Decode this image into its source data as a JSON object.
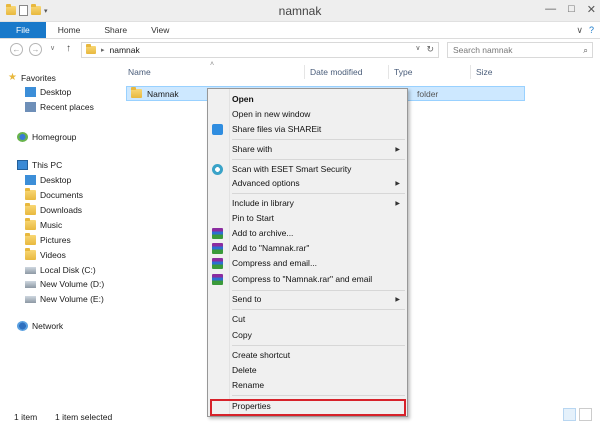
{
  "window": {
    "title": "namnak",
    "controls": [
      "—",
      "□",
      "✕"
    ]
  },
  "ribbon": {
    "tabs": [
      "File",
      "Home",
      "Share",
      "View"
    ],
    "chevron": "∨",
    "help": "?"
  },
  "navigation": {
    "back": "←",
    "forward": "→",
    "recent": "∨",
    "up": "↑",
    "path": [
      "namnak"
    ],
    "path_sep": "▸",
    "address_dropdown": "∨",
    "refresh": "↻",
    "search_placeholder": "Search namnak",
    "search_glyph": "⌕"
  },
  "sidebar": {
    "favorites": "Favorites",
    "favorites_items": [
      "Desktop",
      "Recent places"
    ],
    "homegroup": "Homegroup",
    "thispc": "This PC",
    "thispc_items": [
      "Desktop",
      "Documents",
      "Downloads",
      "Music",
      "Pictures",
      "Videos",
      "Local Disk (C:)",
      "New Volume (D:)",
      "New Volume (E:)"
    ],
    "network": "Network"
  },
  "columns": {
    "sort_indicator": "˄",
    "name": "Name",
    "date": "Date modified",
    "type": "Type",
    "size": "Size"
  },
  "files": [
    {
      "name": "Namnak",
      "type": "folder"
    }
  ],
  "context_menu": {
    "items": [
      {
        "label": "Open",
        "bold": true
      },
      {
        "label": "Open in new window"
      },
      {
        "label": "Share files via SHAREit",
        "icon": "shareit-icon"
      },
      {
        "label": "Share with",
        "submenu": true
      },
      {
        "label": "Scan with ESET Smart Security",
        "icon": "eset-icon"
      },
      {
        "label": "Advanced options",
        "submenu": true
      },
      {
        "label": "Include in library",
        "submenu": true
      },
      {
        "label": "Pin to Start"
      },
      {
        "label": "Add to archive...",
        "icon": "winrar-icon"
      },
      {
        "label": "Add to \"Namnak.rar\"",
        "icon": "winrar-icon"
      },
      {
        "label": "Compress and email...",
        "icon": "winrar-icon"
      },
      {
        "label": "Compress to \"Namnak.rar\" and email",
        "icon": "winrar-icon"
      },
      {
        "label": "Send to",
        "submenu": true
      },
      {
        "label": "Cut"
      },
      {
        "label": "Copy"
      },
      {
        "label": "Create shortcut"
      },
      {
        "label": "Delete"
      },
      {
        "label": "Rename"
      },
      {
        "label": "Properties",
        "highlighted": true
      }
    ],
    "submenu_arrow": "▶",
    "highlight_color": "#d7222a"
  },
  "status": {
    "item_count": "1 item",
    "selected": "1 item selected"
  },
  "colors": {
    "accent": "#1979ca",
    "selection": "#cde8ff"
  }
}
